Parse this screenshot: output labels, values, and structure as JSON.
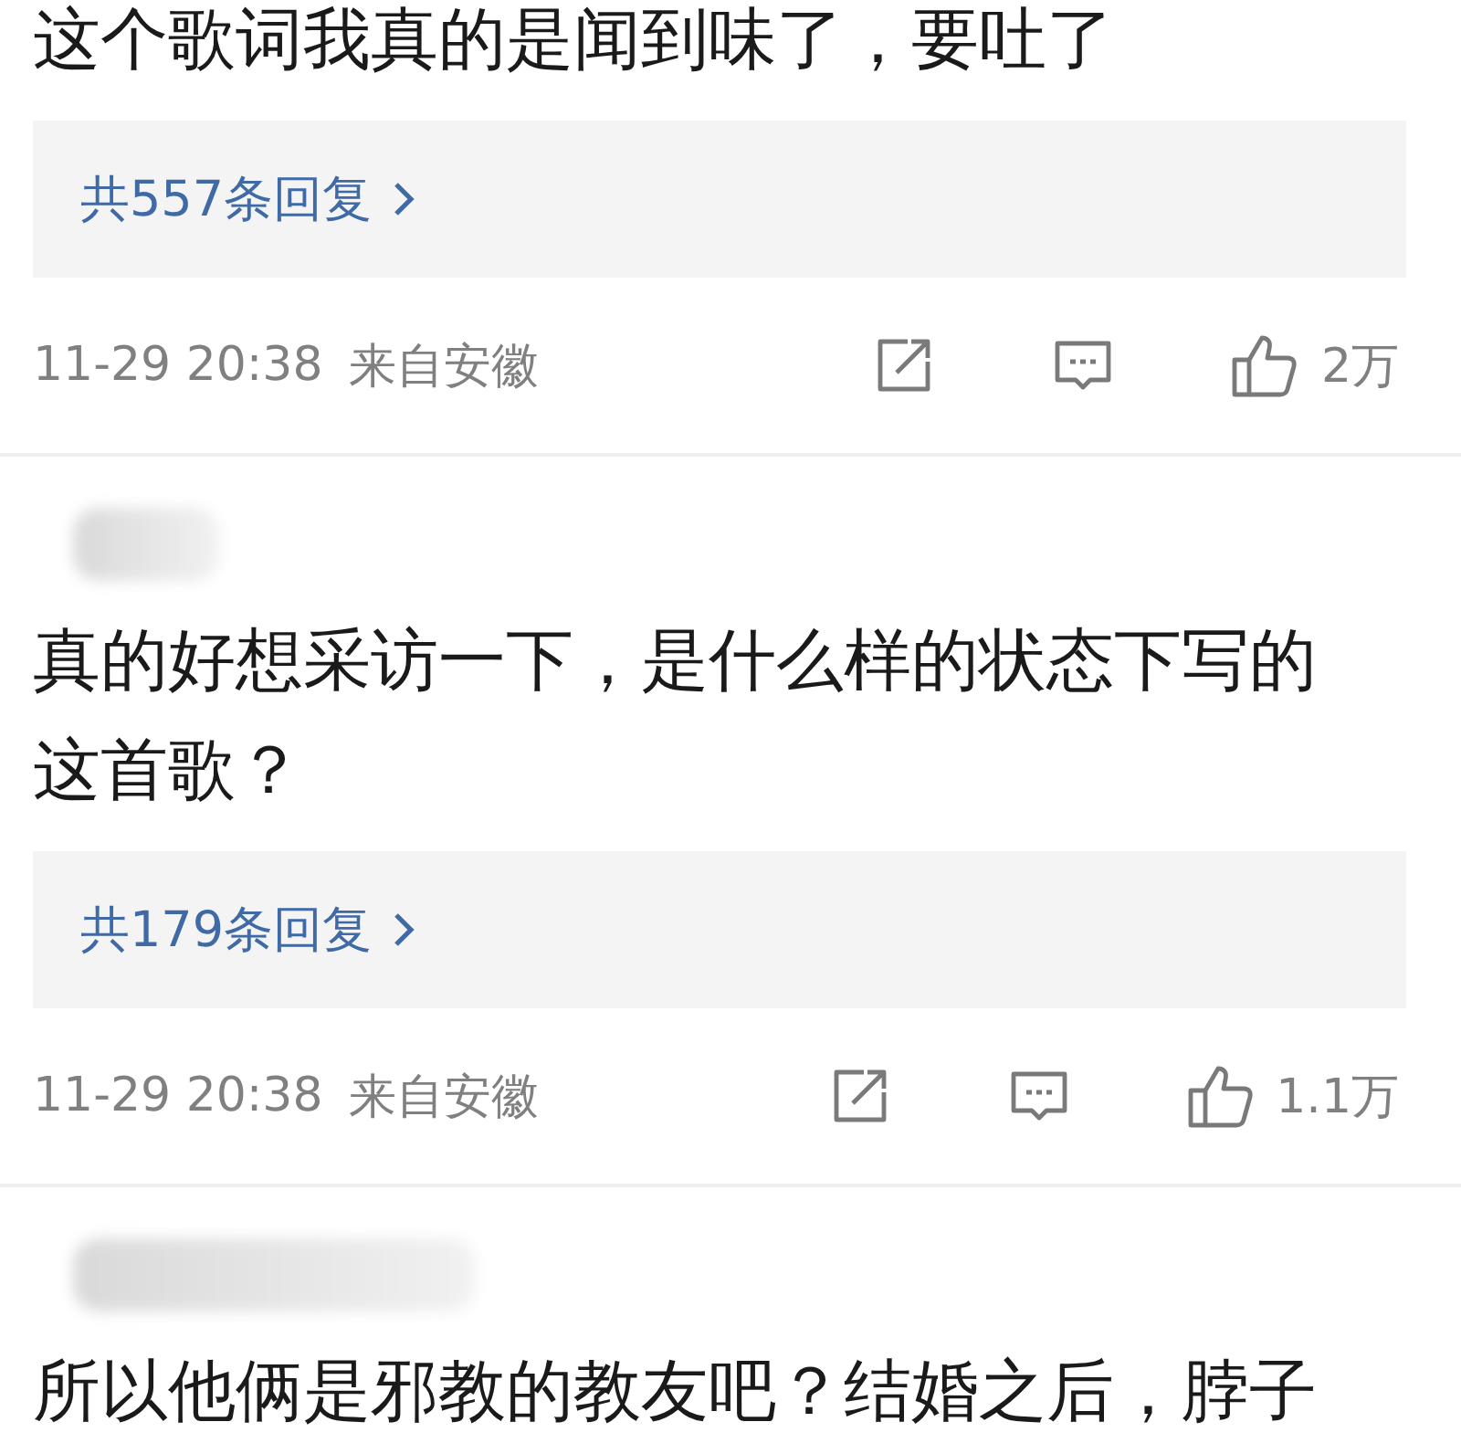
{
  "comments": [
    {
      "text": "这个歌词我真的是闻到味了，要吐了",
      "replies": "共557条回复",
      "time": "11-29 20:38",
      "location": "来自安徽",
      "likes": "2万"
    },
    {
      "text": "真的好想采访一下，是什么样的状态下写的这首歌？",
      "replies": "共179条回复",
      "time": "11-29 20:38",
      "location": "来自安徽",
      "likes": "1.1万",
      "name_blurred": true
    },
    {
      "text": "所以他俩是邪教的教友吧？结婚之后，脖子",
      "name_blurred": true
    }
  ]
}
